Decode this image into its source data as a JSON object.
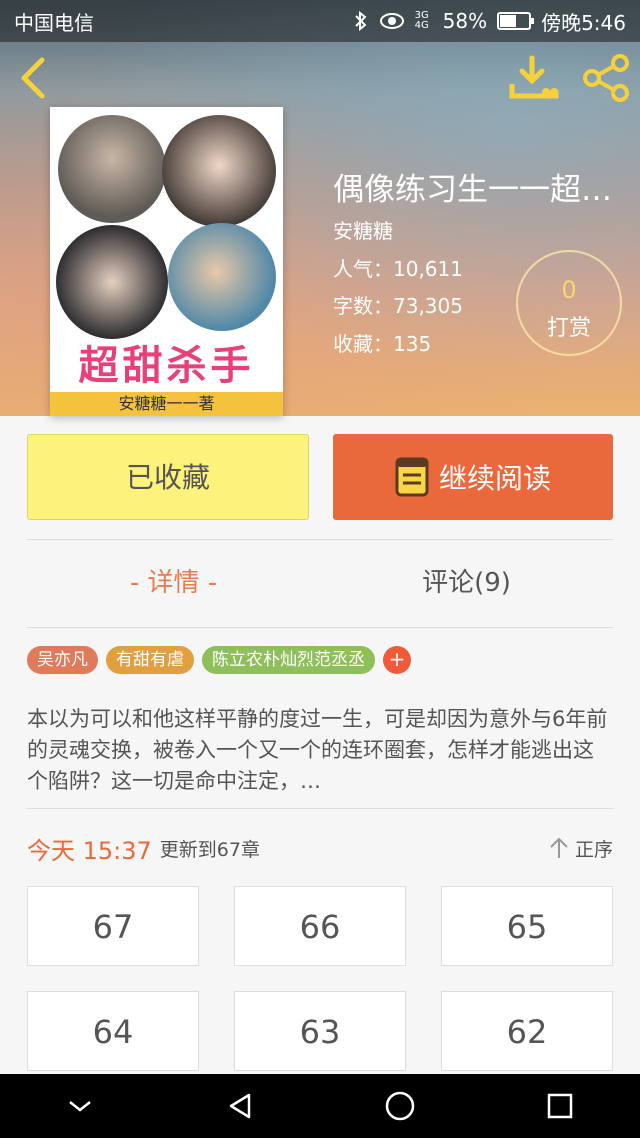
{
  "status_bar": {
    "carrier": "中国电信",
    "signal_label": "3G 4G",
    "battery_percent": "58%",
    "battery_level": 0.58,
    "time": "傍晚5:46"
  },
  "book": {
    "cover_title": "超甜杀手",
    "cover_author": "安糖糖一一著",
    "title": "偶像练习生一一超甜杀手",
    "author": "安糖糖",
    "popularity": "人气：10,611",
    "word_count": "字数：73,305",
    "favorites": "收藏：135"
  },
  "reward": {
    "count": "0",
    "label": "打赏"
  },
  "actions": {
    "collected_label": "已收藏",
    "continue_label": "继续阅读"
  },
  "tabs": {
    "detail": "- 详情 -",
    "comments": "评论(9)"
  },
  "tags": [
    {
      "label": "吴亦凡",
      "color": "#e07a5a"
    },
    {
      "label": "有甜有虐",
      "color": "#e0a040"
    },
    {
      "label": "陈立农朴灿烈范丞丞",
      "color": "#8fbf5a"
    }
  ],
  "tag_add": "+",
  "description": "本以为可以和他这样平静的度过一生，可是却因为意外与6年前的灵魂交换，被卷入一个又一个的连环圈套，怎样才能逃出这个陷阱？这一切是命中注定，…",
  "update": {
    "time": "今天 15:37",
    "text": "更新到67章",
    "sort_label": "正序"
  },
  "chapters": [
    "67",
    "66",
    "65",
    "64",
    "63",
    "62"
  ],
  "colors": {
    "accent": "#ea693c",
    "collected_bg": "#fcf27c"
  }
}
